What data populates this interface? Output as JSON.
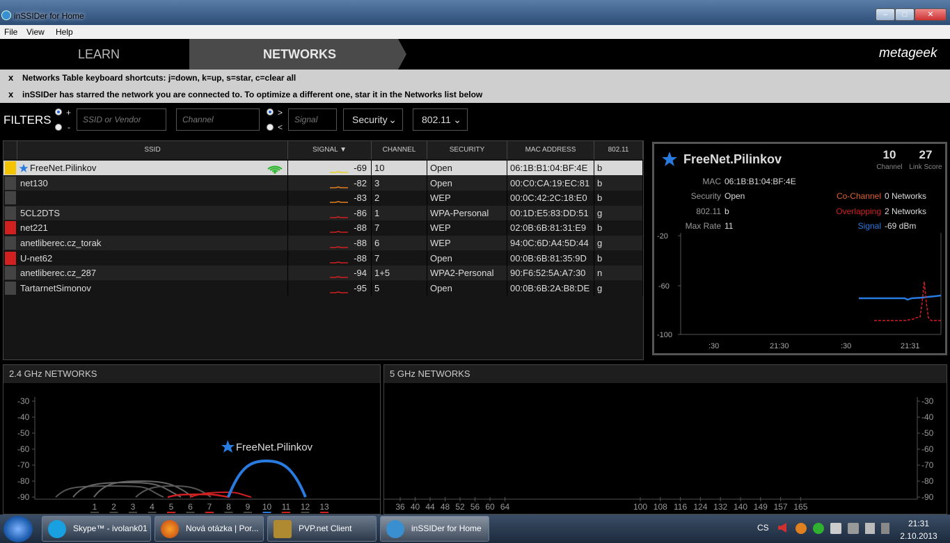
{
  "window": {
    "title": "inSSIDer for Home"
  },
  "menu": [
    "File",
    "View",
    "Help"
  ],
  "nav": {
    "learn": "LEARN",
    "networks": "NETWORKS",
    "logo": "metageek"
  },
  "notices": [
    {
      "close": "x",
      "text": "Networks Table keyboard shortcuts: j=down, k=up, s=star, c=clear all"
    },
    {
      "close": "x",
      "text": "inSSIDer has starred the network you are connected to. To optimize a different one, star it in the Networks list below"
    }
  ],
  "filters": {
    "label": "FILTERS",
    "plus": "+",
    "minus": "-",
    "gt": ">",
    "lt": "<",
    "ssid_placeholder": "SSID or Vendor",
    "channel_placeholder": "Channel",
    "signal_placeholder": "Signal",
    "security": "Security",
    "standard": "802.11"
  },
  "table": {
    "headers": [
      "SSID",
      "SIGNAL",
      "CHANNEL",
      "SECURITY",
      "MAC ADDRESS",
      "802.11"
    ],
    "rows": [
      {
        "swatch": "#f5c400",
        "starred": true,
        "ssid": "FreeNet.Pilinkov",
        "signal": "-69",
        "channel": "10",
        "security": "Open",
        "mac": "06:1B:B1:04:BF:4E",
        "std": "b",
        "color": "#e8d020"
      },
      {
        "swatch": "#444444",
        "ssid": "net130",
        "signal": "-82",
        "channel": "3",
        "security": "Open",
        "mac": "00:C0:CA:19:EC:81",
        "std": "b",
        "color": "#e08020"
      },
      {
        "swatch": "#444444",
        "ssid": "",
        "signal": "-83",
        "channel": "2",
        "security": "WEP",
        "mac": "00:0C:42:2C:18:E0",
        "std": "b",
        "color": "#e08020"
      },
      {
        "swatch": "#444444",
        "ssid": "5CL2DTS",
        "signal": "-86",
        "channel": "1",
        "security": "WPA-Personal",
        "mac": "00:1D:E5:83:DD:51",
        "std": "g",
        "color": "#d02020"
      },
      {
        "swatch": "#d02020",
        "ssid": "net221",
        "signal": "-88",
        "channel": "7",
        "security": "WEP",
        "mac": "02:0B:6B:81:31:E9",
        "std": "b",
        "color": "#d02020"
      },
      {
        "swatch": "#444444",
        "ssid": "anetliberec.cz_torak",
        "signal": "-88",
        "channel": "6",
        "security": "WEP",
        "mac": "94:0C:6D:A4:5D:44",
        "std": "g",
        "color": "#d02020"
      },
      {
        "swatch": "#d02020",
        "ssid": "U-net62",
        "signal": "-88",
        "channel": "7",
        "security": "Open",
        "mac": "00:0B:6B:81:35:9D",
        "std": "b",
        "color": "#d02020"
      },
      {
        "swatch": "#444444",
        "ssid": "anetliberec.cz_287",
        "signal": "-94",
        "channel": "1+5",
        "security": "WPA2-Personal",
        "mac": "90:F6:52:5A:A7:30",
        "std": "n",
        "color": "#d02020"
      },
      {
        "swatch": "#444444",
        "ssid": "TartarnetSimonov",
        "signal": "-95",
        "channel": "5",
        "security": "Open",
        "mac": "00:0B:6B:2A:B8:DE",
        "std": "g",
        "color": "#d02020"
      }
    ]
  },
  "detail": {
    "ssid": "FreeNet.Pilinkov",
    "channel": "10",
    "channel_label": "Channel",
    "link_score": "27",
    "link_score_label": "Link Score",
    "mac_label": "MAC",
    "mac": "06:1B:B1:04:BF:4E",
    "security_label": "Security",
    "security": "Open",
    "std_label": "802.11",
    "std": "b",
    "maxrate_label": "Max Rate",
    "maxrate": "11",
    "cochannel_label": "Co-Channel",
    "cochannel": "0 Networks",
    "overlapping_label": "Overlapping",
    "overlapping": "2 Networks",
    "signal_label": "Signal",
    "signal": "-69 dBm",
    "y_ticks": [
      "-20",
      "-60",
      "-100"
    ],
    "x_ticks": [
      ":30",
      "21:30",
      ":30",
      "21:31"
    ]
  },
  "panels": {
    "ghz24": {
      "title": "2.4 GHz NETWORKS",
      "y_ticks": [
        "-30",
        "-40",
        "-50",
        "-60",
        "-70",
        "-80",
        "-90"
      ],
      "channels": [
        "1",
        "2",
        "3",
        "4",
        "5",
        "6",
        "7",
        "8",
        "9",
        "10",
        "11",
        "12",
        "13"
      ],
      "label": "FreeNet.Pilinkov"
    },
    "ghz5": {
      "title": "5 GHz NETWORKS",
      "y_ticks": [
        "-30",
        "-40",
        "-50",
        "-60",
        "-70",
        "-80",
        "-90"
      ],
      "channels_low": [
        "36",
        "40",
        "44",
        "48",
        "52",
        "56",
        "60",
        "64"
      ],
      "channels_high": [
        "100",
        "108",
        "116",
        "124",
        "132",
        "140",
        "149",
        "157",
        "165"
      ]
    }
  },
  "taskbar": {
    "items": [
      "Skype™ - ivolank01",
      "Nová otázka | Por...",
      "PVP.net Client",
      "inSSIDer for Home"
    ],
    "lang": "CS",
    "time": "21:31",
    "date": "2.10.2013"
  },
  "colors": {
    "accent": "#2a7be0",
    "star": "#2a7be0",
    "overlap": "#d02020"
  }
}
